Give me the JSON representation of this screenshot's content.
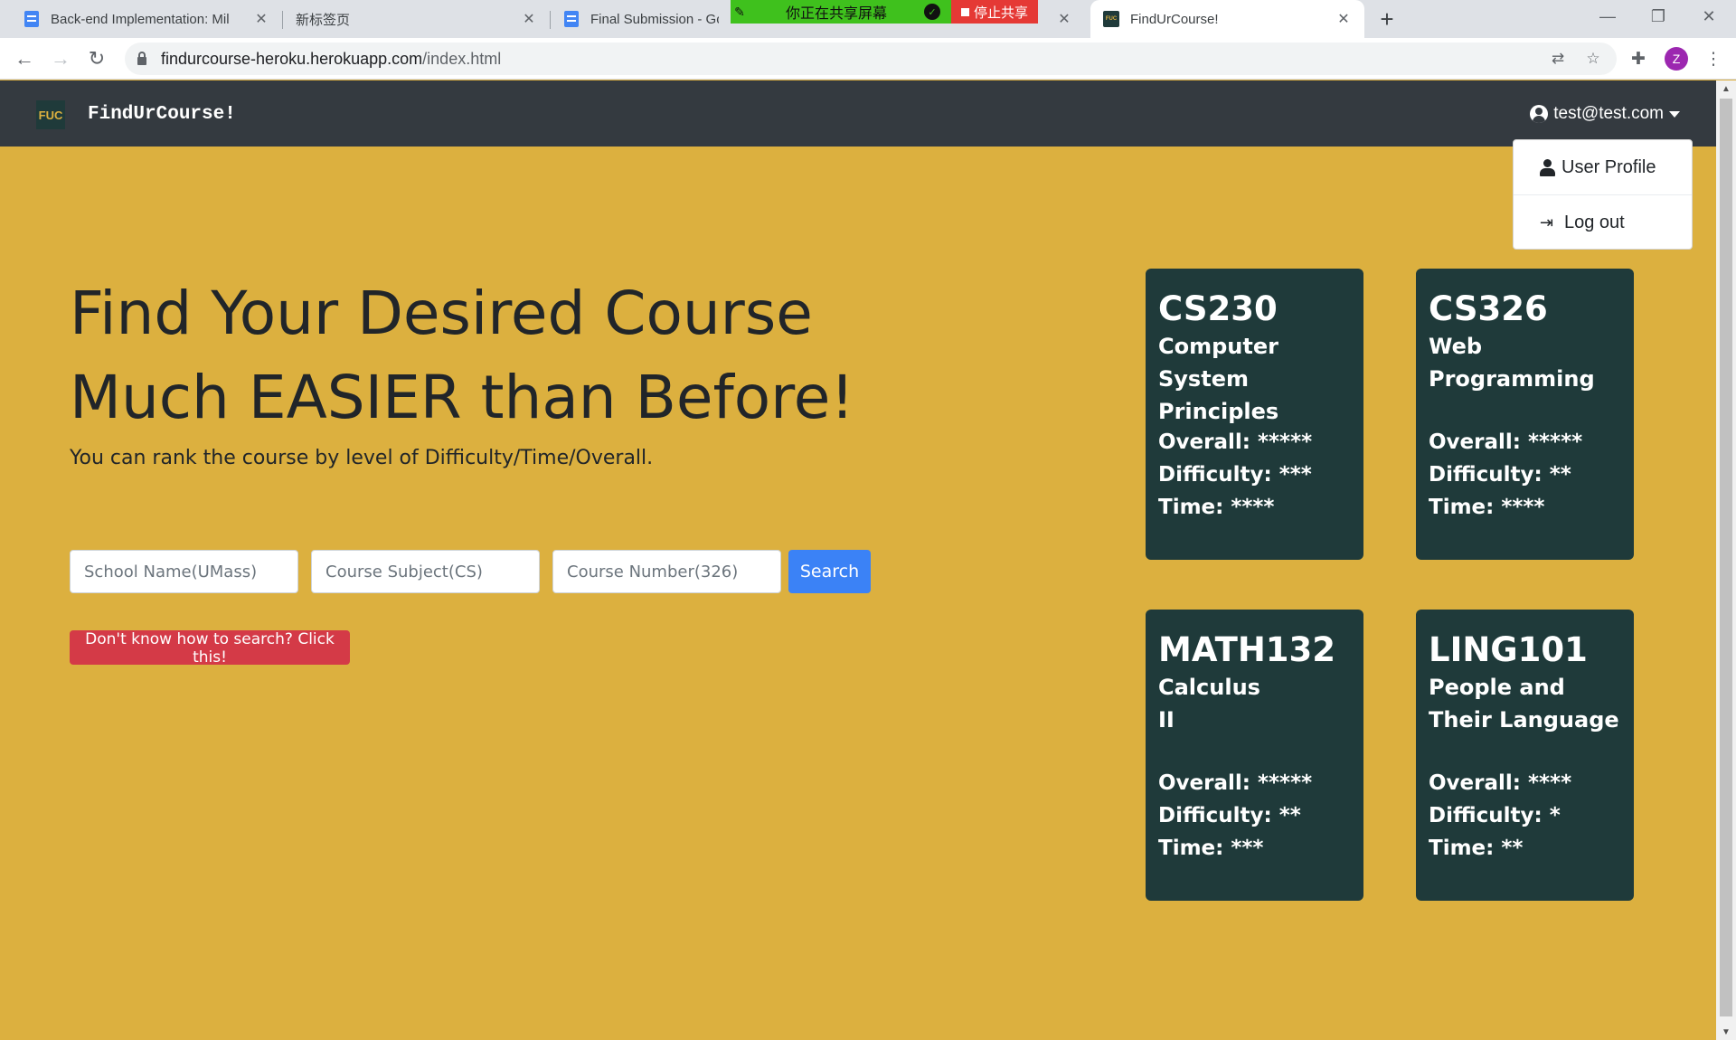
{
  "browser": {
    "tabs": [
      {
        "title": "Back-end Implementation: Mil",
        "icon": "docs-icon"
      },
      {
        "title": "新标签页",
        "icon": "none"
      },
      {
        "title": "Final Submission - Goo",
        "icon": "docs-icon"
      },
      {
        "title": "FindUrCourse!",
        "icon": "fuc-icon"
      }
    ],
    "share_bar": {
      "text": "你正在共享屏幕",
      "stop_label": "停止共享"
    },
    "url_host": "findurcourse-heroku.herokuapp.com",
    "url_path": "/index.html",
    "profile_initial": "Z"
  },
  "navbar": {
    "logo_text": "FUC",
    "brand": "FindUrCourse!",
    "user_email": "test@test.com"
  },
  "user_menu": {
    "items": [
      {
        "label": "User Profile",
        "icon": "user-icon"
      },
      {
        "label": "Log out",
        "icon": "sign-out-icon"
      }
    ]
  },
  "hero": {
    "title_line1": "Find Your Desired Course",
    "title_line2": "Much EASIER than Before!",
    "subtitle": "You can rank the course by level of Difficulty/Time/Overall."
  },
  "search": {
    "school_placeholder": "School Name(UMass)",
    "subject_placeholder": "Course Subject(CS)",
    "number_placeholder": "Course Number(326)",
    "button": "Search",
    "help_button": "Don't know how to search? Click this!"
  },
  "courses": [
    {
      "code": "CS230",
      "name": "Computer System\nPrinciples",
      "stats": "Overall: *****\nDifficulty: ***\nTime: ****"
    },
    {
      "code": "CS326",
      "name": "Web\nProgramming",
      "stats": "Overall: *****\nDifficulty: **\nTime: ****"
    },
    {
      "code": "MATH132",
      "name": "Calculus\nII",
      "stats": "Overall: *****\nDifficulty: **\nTime: ***"
    },
    {
      "code": "LING101",
      "name": "People and\nTheir Language",
      "stats": "Overall: ****\nDifficulty: *\nTime: **"
    }
  ],
  "colors": {
    "page_bg": "#dcb03f",
    "navbar_bg": "#343a40",
    "card_bg": "#1f3a3a",
    "search_button": "#3b82f6",
    "help_button": "#d43a47"
  }
}
